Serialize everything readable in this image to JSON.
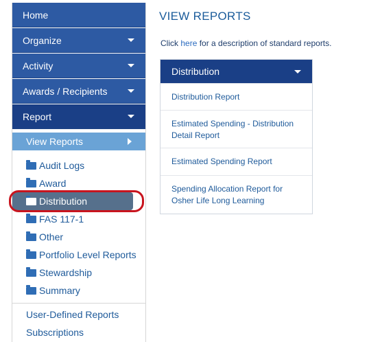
{
  "sidebar": {
    "nav": [
      {
        "label": "Home",
        "dropdown": false
      },
      {
        "label": "Organize",
        "dropdown": true
      },
      {
        "label": "Activity",
        "dropdown": true
      },
      {
        "label": "Awards / Recipients",
        "dropdown": true
      },
      {
        "label": "Report",
        "dropdown": true
      }
    ],
    "active_sub": "View Reports",
    "folders": [
      {
        "label": "Audit Logs"
      },
      {
        "label": "Award"
      },
      {
        "label": "Distribution"
      },
      {
        "label": "FAS 117-1"
      },
      {
        "label": "Other"
      },
      {
        "label": "Portfolio Level Reports"
      },
      {
        "label": "Stewardship"
      },
      {
        "label": "Summary"
      }
    ],
    "links": [
      {
        "label": "User-Defined Reports"
      },
      {
        "label": "Subscriptions"
      }
    ]
  },
  "main": {
    "title": "VIEW REPORTS",
    "intro_before": "Click ",
    "intro_link": "here",
    "intro_after": " for a description of standard reports.",
    "panel": {
      "title": "Distribution",
      "reports": [
        {
          "label": "Distribution Report"
        },
        {
          "label": "Estimated Spending - Distribution Detail Report"
        },
        {
          "label": "Estimated Spending Report"
        },
        {
          "label": "Spending Allocation Report for Osher Life Long Learning"
        }
      ]
    }
  },
  "colors": {
    "nav_bg": "#2d5aa3",
    "nav_active_bg": "#1a3f86",
    "sub_active_bg": "#6aa3d6",
    "highlight_bg": "#56708c",
    "highlight_ring": "#c8141e",
    "link": "#1e5a9a"
  }
}
